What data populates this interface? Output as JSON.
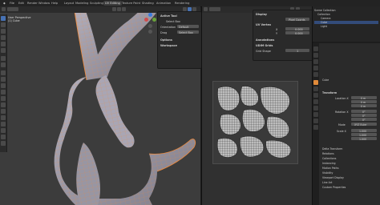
{
  "topbar": {
    "tabs": [
      {
        "label": "File",
        "active": false
      },
      {
        "label": "Edit",
        "active": false
      },
      {
        "label": "Render",
        "active": false
      },
      {
        "label": "Window",
        "active": false
      },
      {
        "label": "Help",
        "active": false
      },
      {
        "label": "Layout",
        "active": false
      },
      {
        "label": "Modeling",
        "active": false
      },
      {
        "label": "Sculpting",
        "active": false
      },
      {
        "label": "UV Editing",
        "active": true
      },
      {
        "label": "Texture Paint",
        "active": false
      },
      {
        "label": "Shading",
        "active": false
      },
      {
        "label": "Animation",
        "active": false
      },
      {
        "label": "Rendering",
        "active": false
      }
    ]
  },
  "viewport": {
    "info_line1": "User Perspective",
    "info_line2": "(1) Cube",
    "npanel": {
      "section1": "Active Tool",
      "row1": "Select Box",
      "row2_label": "Orientation",
      "row2_value": "Default",
      "row3_label": "Drag",
      "row3_value": "Select Box",
      "section2": "Options",
      "section3": "Workspace"
    }
  },
  "uv_editor": {
    "panel": {
      "section1": "Display",
      "row1": "Pixel Coords",
      "section2": "UV Vertex",
      "x_label": "X",
      "x_value": "0.000",
      "y_label": "Y",
      "y_value": "0.000",
      "section3": "Annotations",
      "row2": "UDIM Grids",
      "row3_label": "Grid Shape",
      "row3_value": "1"
    }
  },
  "outliner": {
    "rows": [
      {
        "label": "Scene Collection",
        "selected": false
      },
      {
        "label": "Collection",
        "selected": false
      },
      {
        "label": "Camera",
        "selected": false
      },
      {
        "label": "Cube",
        "selected": true
      },
      {
        "label": "Light",
        "selected": false
      }
    ]
  },
  "properties": {
    "object_name": "Cube",
    "section_transform": "Transform",
    "location_label": "Location X",
    "location_values": [
      "0 m",
      "0 m",
      "0 m"
    ],
    "rotation_label": "Rotation X",
    "rotation_values": [
      "0°",
      "0°",
      "0°"
    ],
    "mode_label": "Mode",
    "mode_value": "XYZ Euler",
    "scale_label": "Scale X",
    "scale_values": [
      "1.000",
      "1.000",
      "1.000"
    ],
    "sections": [
      "Delta Transform",
      "Relations",
      "Collections",
      "Instancing",
      "Motion Paths",
      "Visibility",
      "Viewport Display",
      "Line Art",
      "Custom Properties"
    ]
  },
  "colors": {
    "mesh_fill": "#9d9aa8",
    "wire_edge": "#f08a3a",
    "accent_blue": "#4772b3"
  }
}
